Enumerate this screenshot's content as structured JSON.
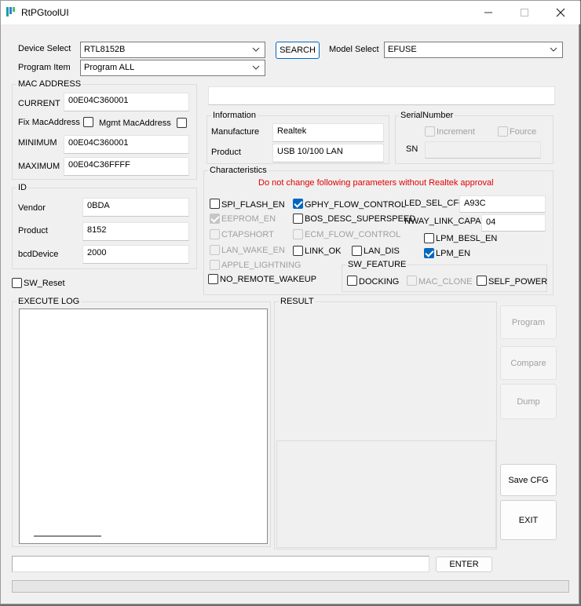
{
  "window": {
    "title": "RtPGtoolUI"
  },
  "top": {
    "device_select_label": "Device Select",
    "device_select_value": "RTL8152B",
    "search_button": "SEARCH",
    "model_select_label": "Model Select",
    "model_select_value": "EFUSE",
    "program_item_label": "Program Item",
    "program_item_value": "Program ALL"
  },
  "mac": {
    "group_title": "MAC ADDRESS",
    "current_label": "CURRENT",
    "current_value": "00E04C360001",
    "fix_label": "Fix MacAddress",
    "mgmt_label": "Mgmt MacAddress",
    "minimum_label": "MINIMUM",
    "minimum_value": "00E04C360001",
    "maximum_label": "MAXIMUM",
    "maximum_value": "00E04C36FFFF"
  },
  "id": {
    "group_title": "ID",
    "vendor_label": "Vendor",
    "vendor_value": "0BDA",
    "product_label": "Product",
    "product_value": "8152",
    "bcd_label": "bcdDevice",
    "bcd_value": "2000"
  },
  "sw_reset_label": "SW_Reset",
  "information": {
    "group_title": "Information",
    "manufacture_label": "Manufacture",
    "manufacture_value": "Realtek",
    "product_label": "Product",
    "product_value": "USB 10/100 LAN"
  },
  "serial": {
    "group_title": "SerialNumber",
    "increment_label": "Increment",
    "fource_label": "Fource",
    "sn_label": "SN"
  },
  "characteristics": {
    "group_title": "Characteristics",
    "warning": "Do not change following parameters without Realtek approval",
    "spi_flash_en": "SPI_FLASH_EN",
    "eeprom_en": "EEPROM_EN",
    "ctapshort": "CTAPSHORT",
    "lan_wake_en": "LAN_WAKE_EN",
    "apple_lightning": "APPLE_LIGHTNING",
    "no_remote_wakeup": "NO_REMOTE_WAKEUP",
    "gphy_flow_control": "GPHY_FLOW_CONTROL",
    "bos_desc_superspeed": "BOS_DESC_SUPERSPEED",
    "ecm_flow_control": "ECM_FLOW_CONTROL",
    "link_ok": "LINK_OK",
    "lan_dis": "LAN_DIS",
    "led_sel_cfg_label": "LED_SEL_CFG",
    "led_sel_cfg_value": "A93C",
    "nway_link_capa_label": "NWAY_LINK_CAPA",
    "nway_link_capa_value": "04",
    "lpm_besl_en": "LPM_BESL_EN",
    "lpm_en": "LPM_EN"
  },
  "sw_feature": {
    "group_title": "SW_FEATURE",
    "docking": "DOCKING",
    "mac_clone": "MAC_CLONE",
    "self_power": "SELF_POWER"
  },
  "log": {
    "execute_title": "EXECUTE LOG",
    "result_title": "RESULT"
  },
  "actions": {
    "program": "Program",
    "compare": "Compare",
    "dump": "Dump",
    "save_cfg": "Save CFG",
    "exit": "EXIT",
    "enter": "ENTER"
  },
  "colors": {
    "accent": "#0067c0",
    "warning": "#e00000"
  }
}
